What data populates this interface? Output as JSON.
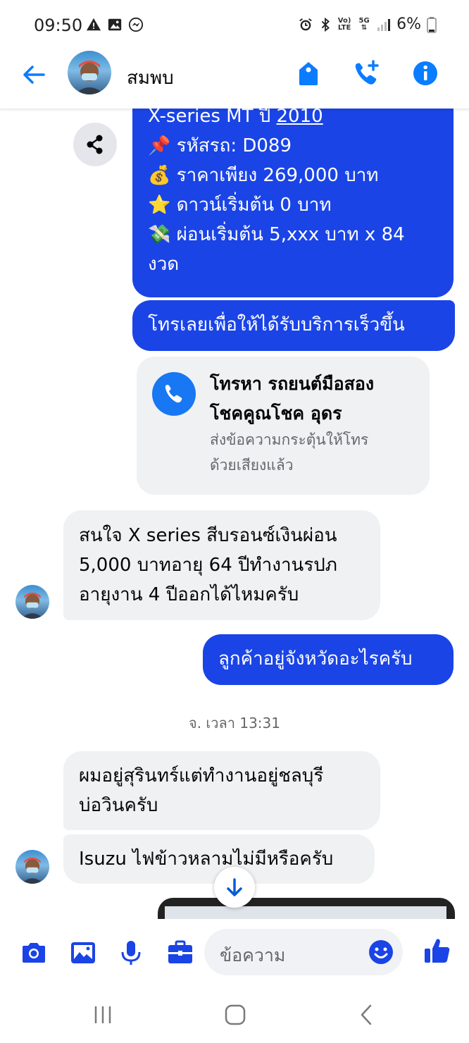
{
  "status_bar": {
    "time": "09:50",
    "network": "5G",
    "volte": "Vo) LTE",
    "battery": "6%"
  },
  "header": {
    "contact_name": "สมพบ"
  },
  "messages": {
    "listing_lines": [
      "X-series MT ปี 2010",
      "📌 รหัสรถ: D089",
      "💰 ราคาเพียง 269,000 บาท",
      "⭐ ดาวน์เริ่มต้น 0 บาท",
      "💸 ผ่อนเริ่มต้น 5,xxx บาท x 84",
      "งวด"
    ],
    "call_prompt": "โทรเลยเพื่อให้ได้รับบริการเร็วขึ้น",
    "call_card": {
      "title_line1": "โทรหา รถยนต์มือสอง",
      "title_line2": "โชคคูณโชค อุดร",
      "sub_line1": "ส่งข้อความกระตุ้นให้โทร",
      "sub_line2": "ด้วยเสียงแล้ว"
    },
    "incoming_1": [
      "สนใจ X series สีบรอนซ์เงินผ่อน",
      "5,000 บาทอายุ 64 ปีทำงานรปภ",
      "อายุงาน 4 ปีออกได้ไหมครับ"
    ],
    "outgoing_1": "ลูกค้าอยู่จังหวัดอะไรครับ",
    "timestamp": "จ. เวลา 13:31",
    "incoming_2": [
      "ผมอยู่สุรินทร์แต่ทำงานอยู่ชลบุรี",
      "บ่อวินครับ"
    ],
    "incoming_3": "Isuzu ไฟข้าวหลามไม่มีหรือครับ"
  },
  "composer": {
    "placeholder": "ข้อความ"
  },
  "colors": {
    "messenger_blue": "#0a7cff",
    "bubble_out": "#1a44e6",
    "bubble_in": "#f0f1f3",
    "icon_blue": "#0a7cff"
  },
  "icons": [
    "back-arrow-icon",
    "tag-icon",
    "call-add-icon",
    "info-icon",
    "share-icon",
    "phone-icon",
    "camera-icon",
    "gallery-icon",
    "mic-icon",
    "briefcase-icon",
    "emoji-icon",
    "like-icon",
    "arrow-down-icon"
  ]
}
